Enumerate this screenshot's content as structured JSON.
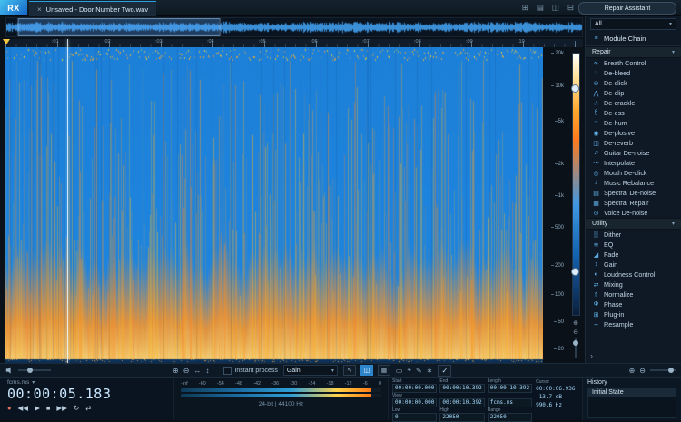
{
  "colors": {
    "accent": "#2d9fe0",
    "spectrogram_low": "#1e86e0",
    "spectrogram_high": "#ff8c1e",
    "time_display": "#c9e8ff"
  },
  "titlebar": {
    "logo": "RX",
    "tab_close": "×",
    "tab_title": "Unsaved - Door Number Two.wav",
    "window_icons": [
      "⊞",
      "▤",
      "◫",
      "⊟"
    ],
    "corner_icon": "⊡"
  },
  "ruler": {
    "labels": [
      {
        "label": ":01",
        "style": "left:51px"
      },
      {
        "label": ":02",
        "style": "left:108px"
      },
      {
        "label": ":03",
        "style": "left:165px"
      },
      {
        "label": ":04",
        "style": "left:222px"
      },
      {
        "label": ":05",
        "style": "left:279px"
      },
      {
        "label": ":06",
        "style": "left:336px"
      },
      {
        "label": ":07",
        "style": "left:393px"
      },
      {
        "label": ":08",
        "style": "left:450px"
      },
      {
        "label": ":09",
        "style": "left:507px"
      },
      {
        "label": ":10",
        "style": "left:564px"
      }
    ]
  },
  "freq_axis": {
    "labels": [
      {
        "label": "20k",
        "style": "top:4px"
      },
      {
        "label": "10k",
        "style": "top:40px"
      },
      {
        "label": "5k",
        "style": "top:79px"
      },
      {
        "label": "2k",
        "style": "top:126px"
      },
      {
        "label": "1k",
        "style": "top:161px"
      },
      {
        "label": "500",
        "style": "top:196px"
      },
      {
        "label": "200",
        "style": "top:238px"
      },
      {
        "label": "100",
        "style": "top:270px"
      },
      {
        "label": "50",
        "style": "top:300px"
      },
      {
        "label": "20",
        "style": "top:330px"
      }
    ]
  },
  "modules": {
    "repair_assistant": "Repair Assistant",
    "filter": "All",
    "caret": "▾",
    "module_chain_icon": "≡",
    "module_chain": "Module Chain",
    "repair_header": "Repair",
    "repair_items": [
      {
        "icon": "∿",
        "label": "Breath Control"
      },
      {
        "icon": "◌",
        "label": "De-bleed"
      },
      {
        "icon": "⊘",
        "label": "De-click"
      },
      {
        "icon": "⋀",
        "label": "De-clip"
      },
      {
        "icon": "∴",
        "label": "De-crackle"
      },
      {
        "icon": "§",
        "label": "De-ess"
      },
      {
        "icon": "≈",
        "label": "De-hum"
      },
      {
        "icon": "◉",
        "label": "De-plosive"
      },
      {
        "icon": "◫",
        "label": "De-reverb"
      },
      {
        "icon": "♫",
        "label": "Guitar De-noise"
      },
      {
        "icon": "⋯",
        "label": "Interpolate"
      },
      {
        "icon": "◎",
        "label": "Mouth De-click"
      },
      {
        "icon": "♪",
        "label": "Music Rebalance"
      },
      {
        "icon": "▤",
        "label": "Spectral De-noise"
      },
      {
        "icon": "▦",
        "label": "Spectral Repair"
      },
      {
        "icon": "⊙",
        "label": "Voice De-noise"
      }
    ],
    "utility_header": "Utility",
    "utility_items": [
      {
        "icon": "▒",
        "label": "Dither"
      },
      {
        "icon": "≋",
        "label": "EQ"
      },
      {
        "icon": "◢",
        "label": "Fade"
      },
      {
        "icon": "↕",
        "label": "Gain"
      },
      {
        "icon": "◐",
        "label": "Loudness Control"
      },
      {
        "icon": "⇄",
        "label": "Mixing"
      },
      {
        "icon": "⇑",
        "label": "Normalize"
      },
      {
        "icon": "Φ",
        "label": "Phase"
      },
      {
        "icon": "⊞",
        "label": "Plug-in"
      },
      {
        "icon": "∼",
        "label": "Resample"
      }
    ],
    "collapse_arrow": "›"
  },
  "toolbar": {
    "zoom_in": "⊕",
    "zoom_out": "⊖",
    "zoom_h": "↔",
    "zoom_v": "↕",
    "instant_process": "Instant process",
    "process": "Gain",
    "view_wave": "∿",
    "view_split": "◫",
    "view_spec": "▦",
    "tool_select": "▭",
    "tool_lasso": "⌖",
    "tool_brush": "✎",
    "tool_wand": "∗",
    "apply": "✓"
  },
  "transport": {
    "format": "fcms.ms",
    "time": "00:00:05.183",
    "buttons": [
      "●",
      "◀◀",
      "▶",
      "■",
      "▶▶",
      "↻",
      "⇄"
    ]
  },
  "meter": {
    "unit": "dB",
    "scale": [
      "-inf",
      "-60",
      "-54",
      "-48",
      "-42",
      "-36",
      "-30",
      "-24",
      "-18",
      "-12",
      "-6",
      "0"
    ],
    "info": "24-bit | 44100 Hz"
  },
  "info": {
    "cells": [
      {
        "label": "Start",
        "value": "00:00:00.000"
      },
      {
        "label": "End",
        "value": "00:00:10.392"
      },
      {
        "label": "Length",
        "value": "00:00:10.392"
      },
      {
        "label": "View",
        "value": "00:00:00.000"
      },
      {
        "label": "",
        "value": "00:00:10.392"
      },
      {
        "label": "",
        "value": "fcms.ms"
      },
      {
        "label": "Low",
        "value": "0"
      },
      {
        "label": "High",
        "value": "22050"
      },
      {
        "label": "Range",
        "value": "22050"
      }
    ],
    "cursor": {
      "label": "Cursor",
      "time": "00:00:06.936",
      "db": "-13.7 dB",
      "hz": "990.6 Hz"
    }
  },
  "history": {
    "title": "History",
    "items": [
      "Initial State"
    ]
  }
}
